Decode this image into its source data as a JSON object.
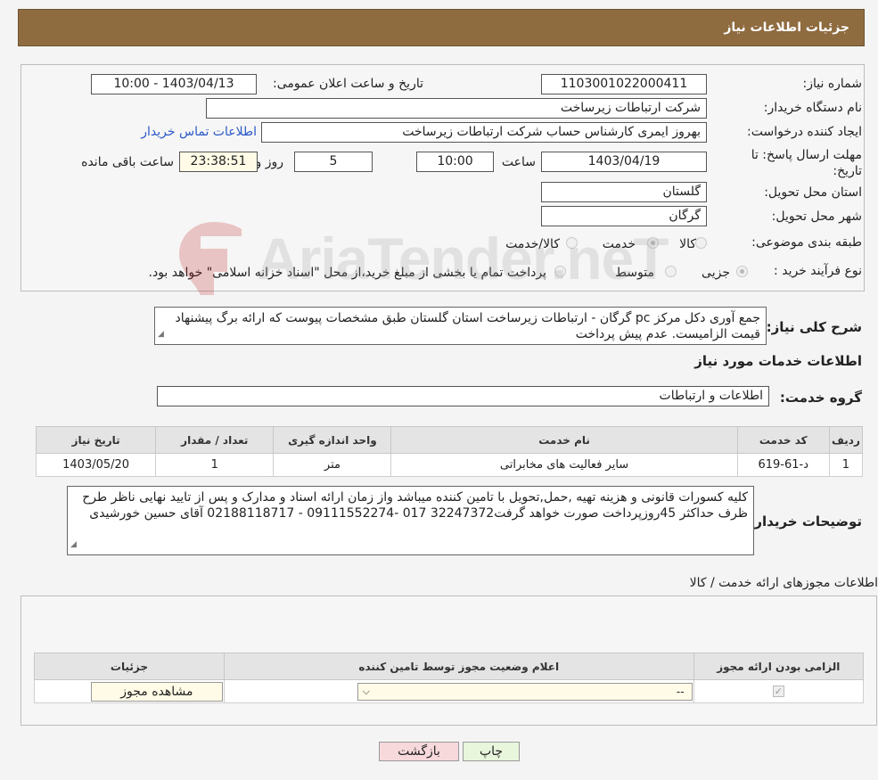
{
  "header": {
    "title": "جزئیات اطلاعات نیاز"
  },
  "form": {
    "need_number_label": "شماره نیاز:",
    "need_number": "1103001022000411",
    "announce_label": "تاریخ و ساعت اعلان عمومی:",
    "announce_value": "1403/04/13 - 10:00",
    "buyer_org_label": "نام دستگاه خریدار:",
    "buyer_org": "شرکت ارتباطات زیرساخت",
    "creator_label": "ایجاد کننده درخواست:",
    "creator": "بهروز ایمری کارشناس حساب شرکت ارتباطات زیرساخت",
    "buyer_contact_link": "اطلاعات تماس خریدار",
    "deadline_label": "مهلت ارسال پاسخ: تا تاریخ:",
    "deadline_date": "1403/04/19",
    "time_label": "ساعت",
    "deadline_time": "10:00",
    "days_value": "5",
    "days_label": "روز و",
    "remaining_time": "23:38:51",
    "remaining_label": "ساعت باقی مانده",
    "province_label": "استان محل تحویل:",
    "province": "گلستان",
    "city_label": "شهر محل تحویل:",
    "city": "گرگان",
    "category_label": "طبقه بندی موضوعی:",
    "category_options": [
      "کالا",
      "خدمت",
      "کالا/خدمت"
    ],
    "category_selected": "خدمت",
    "purchase_type_label": "نوع فرآیند خرید :",
    "purchase_options": [
      "جزیی",
      "متوسط"
    ],
    "purchase_note": "پرداخت تمام یا بخشی از مبلغ خرید،از محل \"اسناد خزانه اسلامی\" خواهد بود."
  },
  "description": {
    "label": "شرح کلی نیاز:",
    "text": "جمع آوری دکل مرکز pc  گرگان  - ارتباطات زیرساخت استان گلستان طبق مشخصات پیوست که ارائه برگ پیشنهاد قیمت الزامیست. عدم پیش پرداخت"
  },
  "services": {
    "section_title": "اطلاعات خدمات مورد نیاز",
    "group_label": "گروه خدمت:",
    "group_value": "اطلاعات و ارتباطات",
    "columns": [
      "ردیف",
      "کد خدمت",
      "نام خدمت",
      "واحد اندازه گیری",
      "تعداد / مقدار",
      "تاریخ نیاز"
    ],
    "rows": [
      [
        "1",
        "د-61-619",
        "سایر فعالیت های مخابراتی",
        "متر",
        "1",
        "1403/05/20"
      ]
    ]
  },
  "buyer_notes": {
    "label": "توضیحات خریدار:",
    "text": "کلیه کسورات قانونی و هزینه تهیه ,حمل,تحویل با تامین کننده میباشد واز زمان ارائه اسناد و مدارک و پس از تایید نهایی ناظر طرح ظرف حداکثر 45روزپرداخت صورت خواهد گرفت32247372 017 -09111552274 - 02188118717 آقای حسین خورشیدی"
  },
  "licenses": {
    "section_title": "اطلاعات مجوزهای ارائه خدمت / کالا",
    "columns": [
      "الزامی بودن ارائه مجوز",
      "اعلام وضعیت مجوز توسط تامین کننده",
      "جزئیات"
    ],
    "select_value": "--",
    "view_button": "مشاهده مجوز"
  },
  "footer": {
    "print_button": "چاپ",
    "back_button": "بازگشت"
  },
  "watermark": {
    "text": "AriaTender.neT"
  },
  "colors": {
    "header_bg": "#8f6b40",
    "link": "#2a58c7",
    "back_button_bg": "#f7d9dc",
    "print_button_bg": "#e8f6dc"
  }
}
